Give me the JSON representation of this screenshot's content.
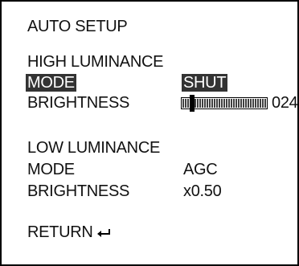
{
  "menu": {
    "title": "AUTO SETUP",
    "high": {
      "heading": "HIGH LUMINANCE",
      "mode_label": "MODE",
      "mode_value": "SHUT",
      "brightness_label": "BRIGHTNESS",
      "brightness_value": "024",
      "brightness_level": 0.24
    },
    "low": {
      "heading": "LOW LUMINANCE",
      "mode_label": "MODE",
      "mode_value": "AGC",
      "brightness_label": "BRIGHTNESS",
      "brightness_value": "x0.50"
    },
    "return_label": "RETURN",
    "return_icon": "enter-arrow-icon"
  }
}
